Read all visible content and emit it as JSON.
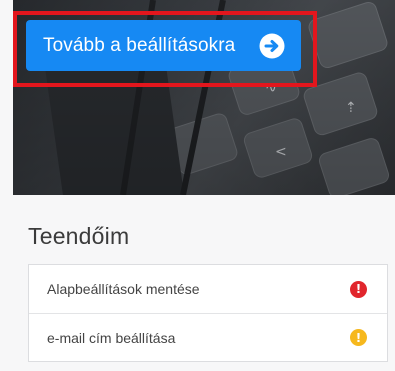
{
  "hero": {
    "cta_label": "Tovább a beállításokra",
    "cta_icon": "arrow-right-circle-icon",
    "cta_color": "#1689f3",
    "highlight_color": "#e3161d"
  },
  "todos": {
    "title": "Teendőim",
    "items": [
      {
        "label": "Alapbeállítások mentése",
        "status": "error",
        "status_icon": "exclamation-circle-icon",
        "status_color": "#e1262d",
        "glyph": "!"
      },
      {
        "label": "e-mail cím beállítása",
        "status": "warning",
        "status_icon": "exclamation-circle-icon",
        "status_color": "#f6b81e",
        "glyph": "!"
      }
    ]
  }
}
